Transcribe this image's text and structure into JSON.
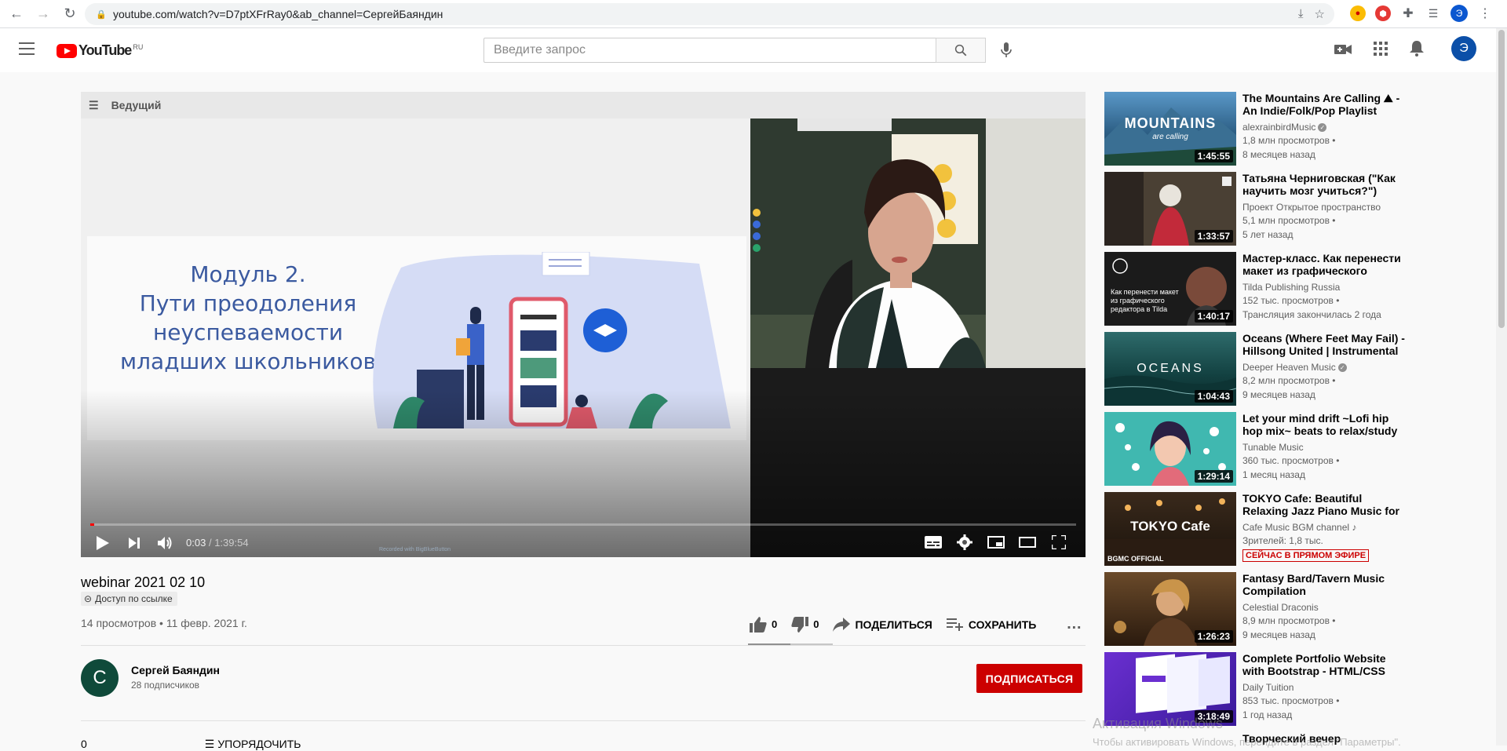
{
  "browser": {
    "url": "youtube.com/watch?v=D7ptXFrRay0&ab_channel=СергейБаяндин",
    "profile_initial": "Э"
  },
  "header": {
    "logo_text": "YouTube",
    "logo_country": "RU",
    "search_placeholder": "Введите запрос",
    "avatar_initial": "Э"
  },
  "player": {
    "presenter_label": "Ведущий",
    "slide_title_lines": [
      "Модуль 2.",
      "Пути преодоления",
      "неуспеваемости",
      "младших школьников"
    ],
    "time_current": "0:03",
    "time_separator": "/",
    "time_total": "1:39:54",
    "progress_fraction": 0.0005,
    "watermark": "Recorded with BigBlueButton"
  },
  "video": {
    "title": "webinar 2021 02 10",
    "access_badge": "Доступ по ссылке",
    "views_date": "14 просмотров • 11 февр. 2021 г.",
    "likes": "0",
    "dislikes": "0",
    "share_label": "ПОДЕЛИТЬСЯ",
    "save_label": "СОХРАНИТЬ",
    "more_label": "…"
  },
  "channel": {
    "initial": "С",
    "name": "Сергей Баяндин",
    "subscribers": "28 подписчиков",
    "subscribe_label": "ПОДПИСАТЬСЯ"
  },
  "comments_peek": {
    "count": "0",
    "sort_label": "УПОРЯДОЧИТЬ"
  },
  "recommendations": [
    {
      "title": "The Mountains Are Calling ⛰ - An Indie/Folk/Pop Playlist",
      "channel": "alexrainbirdMusic",
      "verified": true,
      "views": "1,8 млн просмотров •",
      "age": "8 месяцев назад",
      "duration": "1:45:55",
      "thumb_text": "MOUNTAINS",
      "thumb_sub": "are calling"
    },
    {
      "title": "Татьяна Черниговская (\"Как научить мозг учиться?\")",
      "channel": "Проект Открытое пространство",
      "verified": false,
      "views": "5,1 млн просмотров •",
      "age": "5 лет назад",
      "duration": "1:33:57",
      "thumb_text": "",
      "thumb_sub": ""
    },
    {
      "title": "Мастер-класс. Как перенести макет из графического редактора в Tilda",
      "channel": "Tilda Publishing Russia",
      "verified": false,
      "views": "152 тыс. просмотров •",
      "age": "Трансляция закончилась 2 года",
      "duration": "1:40:17",
      "thumb_text": "Как перенести макет из графического редактора в Tilda",
      "thumb_sub": ""
    },
    {
      "title": "Oceans (Where Feet May Fail) - Hillsong United | Instrumental Worship",
      "channel": "Deeper Heaven Music",
      "verified": true,
      "views": "8,2 млн просмотров •",
      "age": "9 месяцев назад",
      "duration": "1:04:43",
      "thumb_text": "OCEANS",
      "thumb_sub": ""
    },
    {
      "title": "Let your mind drift ~Lofi hip hop mix~ beats to relax/study to ~...",
      "channel": "Tunable Music",
      "verified": false,
      "views": "360 тыс. просмотров •",
      "age": "1 месяц назад",
      "duration": "1:29:14",
      "thumb_text": "",
      "thumb_sub": ""
    },
    {
      "title": "TOKYO Cafe: Beautiful Relaxing Jazz Piano Music for Stress Relief",
      "channel": "Cafe Music BGM channel ♪",
      "verified": false,
      "views": "Зрителей: 1,8 тыс.",
      "age": "",
      "live": "СЕЙЧАС В ПРЯМОМ ЭФИРЕ",
      "duration": "",
      "thumb_text": "TOKYO Cafe",
      "thumb_sub": "BGMC OFFICIAL"
    },
    {
      "title": "Fantasy Bard/Tavern Music Compilation",
      "channel": "Celestial Draconis",
      "verified": false,
      "views": "8,9 млн просмотров •",
      "age": "9 месяцев назад",
      "duration": "1:26:23",
      "thumb_text": "",
      "thumb_sub": ""
    },
    {
      "title": "Complete Portfolio Website with Bootstrap - HTML/CSS",
      "channel": "Daily Tuition",
      "verified": false,
      "views": "853 тыс. просмотров •",
      "age": "1 год назад",
      "duration": "3:18:49",
      "thumb_text": "",
      "thumb_sub": ""
    },
    {
      "title": "Творческий вечер",
      "channel": "",
      "verified": false,
      "views": "",
      "age": "",
      "duration": "",
      "thumb_text": "",
      "thumb_sub": ""
    }
  ],
  "os_watermark": {
    "line1": "Активация Windows",
    "line2": "Чтобы активировать Windows, перейдите в раздел \"Параметры\"."
  }
}
